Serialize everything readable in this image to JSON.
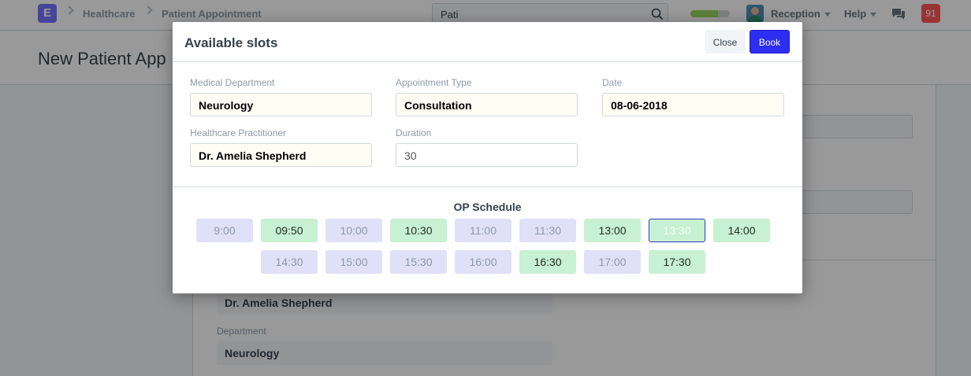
{
  "navbar": {
    "logo": "E",
    "breadcrumbs": [
      "Healthcare",
      "Patient Appointment"
    ],
    "search_value": "Pati",
    "progress_fraction": 0.7,
    "user_menu": "Reception",
    "help_menu": "Help",
    "notification_count": "91"
  },
  "page": {
    "title": "New Patient App",
    "bg_practitioner": "Dr. Amelia Shepherd",
    "bg_department_label": "Department",
    "bg_department": "Neurology"
  },
  "modal": {
    "title": "Available slots",
    "close_label": "Close",
    "book_label": "Book",
    "fields": {
      "medical_department": {
        "label": "Medical Department",
        "value": "Neurology"
      },
      "appointment_type": {
        "label": "Appointment Type",
        "value": "Consultation"
      },
      "date": {
        "label": "Date",
        "value": "08-06-2018"
      },
      "practitioner": {
        "label": "Healthcare Practitioner",
        "value": "Dr. Amelia Shepherd"
      },
      "duration": {
        "label": "Duration",
        "value": "30"
      }
    },
    "schedule_title": "OP Schedule",
    "slots": [
      {
        "time": "9:00",
        "status": "unavailable"
      },
      {
        "time": "09:50",
        "status": "available"
      },
      {
        "time": "10:00",
        "status": "unavailable"
      },
      {
        "time": "10:30",
        "status": "available"
      },
      {
        "time": "11:00",
        "status": "unavailable"
      },
      {
        "time": "11:30",
        "status": "unavailable"
      },
      {
        "time": "13:00",
        "status": "available"
      },
      {
        "time": "13:30",
        "status": "selected"
      },
      {
        "time": "14:00",
        "status": "available"
      },
      {
        "time": "14:30",
        "status": "unavailable"
      },
      {
        "time": "15:00",
        "status": "unavailable"
      },
      {
        "time": "15:30",
        "status": "unavailable"
      },
      {
        "time": "16:00",
        "status": "unavailable"
      },
      {
        "time": "16:30",
        "status": "available"
      },
      {
        "time": "17:00",
        "status": "unavailable"
      },
      {
        "time": "17:30",
        "status": "available"
      }
    ]
  },
  "colors": {
    "primary": "#2e2ef2",
    "slot_available": "#c8f0d2",
    "slot_unavailable": "#e0e0f8",
    "notification": "#ff5858"
  }
}
